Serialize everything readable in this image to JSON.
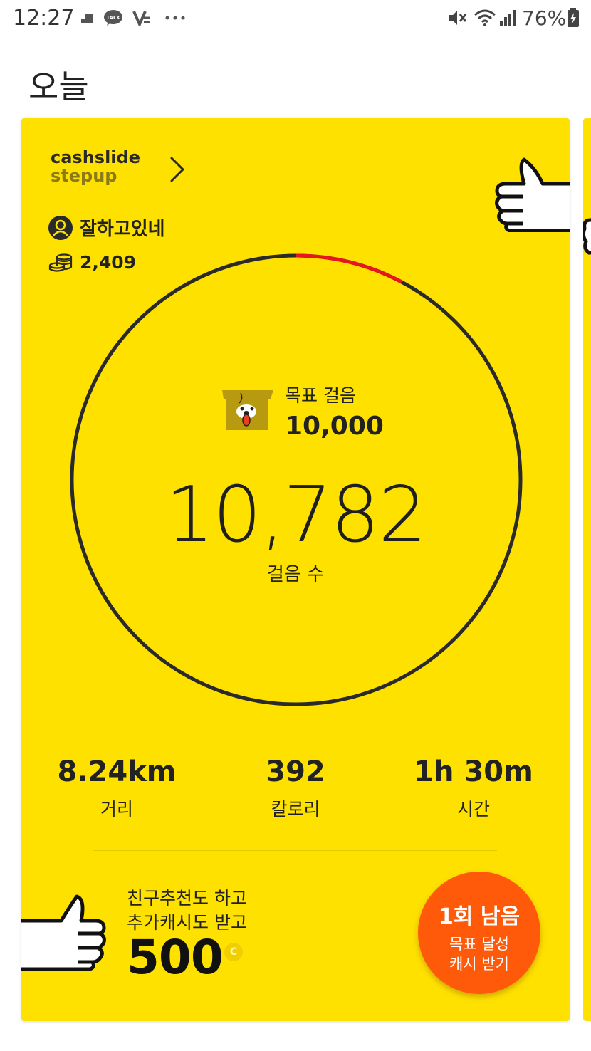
{
  "status_bar": {
    "time": "12:27",
    "battery": "76%",
    "left_icons": [
      "notification-icon",
      "kakaotalk-icon",
      "v-app-icon",
      "more-dots-icon"
    ],
    "right_icons": [
      "mute-icon",
      "wifi-icon",
      "signal-icon",
      "battery-icon"
    ]
  },
  "page": {
    "title": "오늘"
  },
  "card": {
    "brand_line1": "cashslide",
    "brand_line2": "stepup",
    "user_name": "잘하고있네",
    "coins": "2,409",
    "goal_label": "목표 걸음",
    "goal_value": "10,000",
    "steps_value": "10,782",
    "steps_label": "걸음 수",
    "progress_fraction": 1.0,
    "stats": [
      {
        "value": "8.24km",
        "label": "거리"
      },
      {
        "value": "392",
        "label": "칼로리"
      },
      {
        "value": "1h 30m",
        "label": "시간"
      }
    ],
    "promo": {
      "line1": "친구추천도 하고",
      "line2": "추가캐시도 받고",
      "amount": "500",
      "coin_symbol": "C"
    },
    "cta": {
      "title": "1회 남음",
      "sub1": "목표 달성",
      "sub2": "캐시 받기"
    }
  },
  "colors": {
    "card_bg": "#FFE100",
    "ring": "#2a2a2a",
    "ring_highlight": "#E8141E",
    "cta": "#FF5A0A"
  }
}
